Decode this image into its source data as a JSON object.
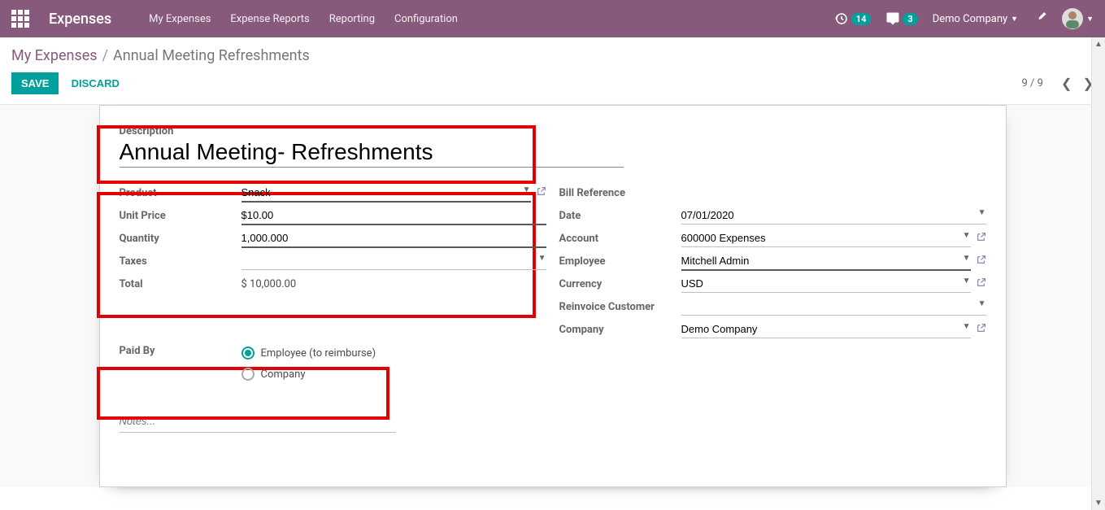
{
  "navbar": {
    "brand": "Expenses",
    "links": [
      "My Expenses",
      "Expense Reports",
      "Reporting",
      "Configuration"
    ],
    "activity_badge": "14",
    "chat_badge": "3",
    "company": "Demo Company"
  },
  "breadcrumb": {
    "root": "My Expenses",
    "sep": "/",
    "current": "Annual Meeting Refreshments"
  },
  "buttons": {
    "save": "SAVE",
    "discard": "DISCARD"
  },
  "pager": {
    "text": "9 / 9"
  },
  "title": {
    "label": "Description",
    "value": "Annual Meeting- Refreshments"
  },
  "left_fields": {
    "product": {
      "label": "Product",
      "value": "Snack"
    },
    "unit_price": {
      "label": "Unit Price",
      "value": "$10.00"
    },
    "quantity": {
      "label": "Quantity",
      "value": "1,000.000"
    },
    "taxes": {
      "label": "Taxes",
      "value": ""
    },
    "total": {
      "label": "Total",
      "value": "$ 10,000.00"
    }
  },
  "right_fields": {
    "bill_ref": {
      "label": "Bill Reference",
      "value": ""
    },
    "date": {
      "label": "Date",
      "value": "07/01/2020"
    },
    "account": {
      "label": "Account",
      "value": "600000 Expenses"
    },
    "employee": {
      "label": "Employee",
      "value": "Mitchell Admin"
    },
    "currency": {
      "label": "Currency",
      "value": "USD"
    },
    "reinvoice": {
      "label": "Reinvoice Customer",
      "value": ""
    },
    "company": {
      "label": "Company",
      "value": "Demo Company"
    }
  },
  "paid_by": {
    "label": "Paid By",
    "opt1": "Employee (to reimburse)",
    "opt2": "Company"
  },
  "notes": {
    "placeholder": "Notes..."
  }
}
